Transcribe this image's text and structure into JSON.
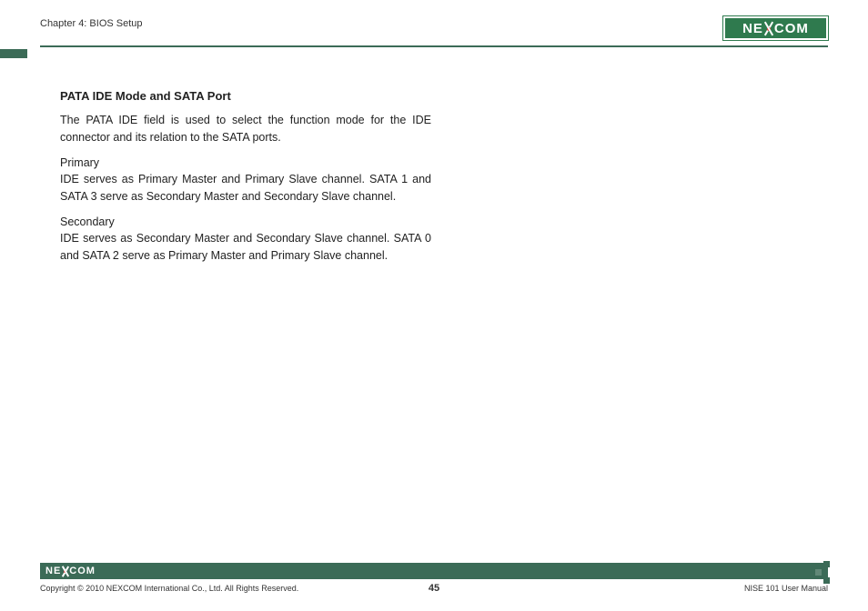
{
  "header": {
    "chapter_label": "Chapter 4: BIOS Setup",
    "logo_text_left": "NE",
    "logo_text_right": "COM"
  },
  "content": {
    "section_title": "PATA IDE Mode and SATA Port",
    "intro": "The PATA IDE field is used to select the function mode for the IDE connector and its relation to the SATA ports.",
    "primary_label": "Primary",
    "primary_desc": "IDE serves as Primary Master and Primary Slave channel. SATA 1 and SATA 3 serve as Secondary Master and Secondary Slave channel.",
    "secondary_label": "Secondary",
    "secondary_desc": "IDE serves as Secondary Master and Secondary Slave channel. SATA 0 and SATA 2 serve as Primary Master and Primary Slave channel."
  },
  "footer": {
    "logo_text_left": "NE",
    "logo_text_right": "COM",
    "copyright": "Copyright © 2010 NEXCOM International Co., Ltd. All Rights Reserved.",
    "page_number": "45",
    "manual_name": "NISE 101 User Manual"
  }
}
